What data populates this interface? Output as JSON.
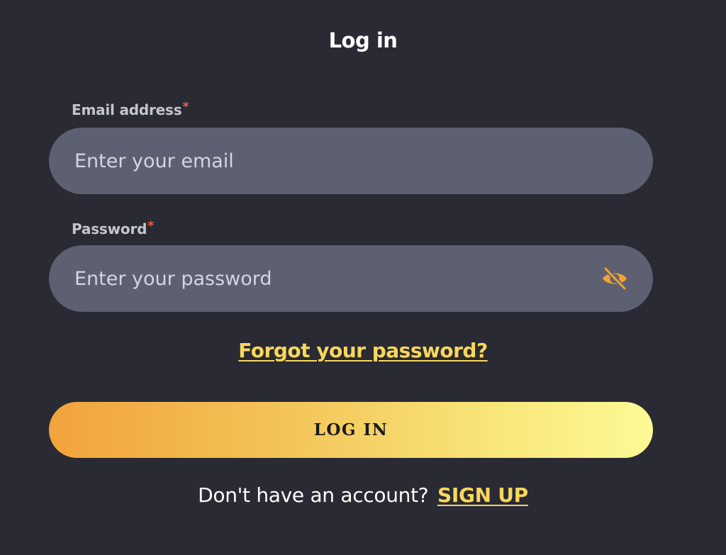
{
  "header": {
    "title": "Log in"
  },
  "email": {
    "label": "Email address",
    "required_mark": "*",
    "placeholder": "Enter your email",
    "value": ""
  },
  "password": {
    "label": "Password",
    "required_mark": "*",
    "placeholder": "Enter your password",
    "value": "",
    "toggle_icon": "eye-slash-icon"
  },
  "links": {
    "forgot_password": "Forgot your password?"
  },
  "actions": {
    "login_label": "LOG IN"
  },
  "signup": {
    "prompt": "Don't have an account?",
    "link_label": "SIGN UP"
  },
  "colors": {
    "background": "#292a33",
    "input_background": "#5c6070",
    "accent_yellow": "#f9d75a",
    "required_red": "#f0653e",
    "eye_icon_orange": "#f2a133",
    "button_gradient_start": "#f2a33c",
    "button_gradient_end": "#fcfa96"
  }
}
